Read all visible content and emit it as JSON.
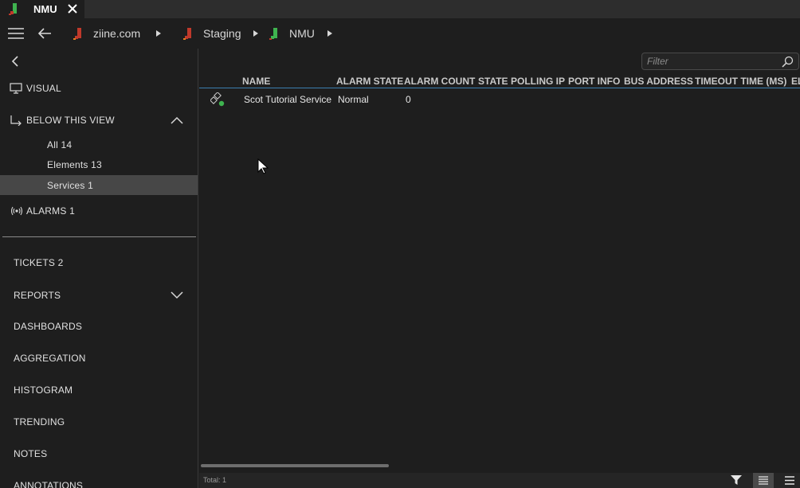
{
  "tab": {
    "label": "NMU",
    "icon": "element-icon"
  },
  "nav": {
    "breadcrumbs": [
      {
        "label": "ziine.com",
        "icon": "view-icon-red"
      },
      {
        "label": "Staging",
        "icon": "view-icon-red"
      },
      {
        "label": "NMU",
        "icon": "element-icon-green"
      }
    ]
  },
  "sidebar": {
    "visual_label": "VISUAL",
    "below_label": "BELOW THIS VIEW",
    "sub_items": [
      {
        "label": "All 14"
      },
      {
        "label": "Elements 13"
      },
      {
        "label": "Services 1",
        "selected": true
      }
    ],
    "alarms_label": "ALARMS 1",
    "items": [
      {
        "label": "TICKETS 2"
      },
      {
        "label": "REPORTS"
      },
      {
        "label": "DASHBOARDS"
      },
      {
        "label": "AGGREGATION"
      },
      {
        "label": "HISTOGRAM"
      },
      {
        "label": "TRENDING"
      },
      {
        "label": "NOTES"
      },
      {
        "label": "ANNOTATIONS"
      }
    ]
  },
  "filter": {
    "placeholder": "Filter"
  },
  "table": {
    "columns": [
      "NAME",
      "ALARM STATE",
      "ALARM COUNT",
      "STATE",
      "POLLING IP",
      "PORT INFO",
      "BUS ADDRESS",
      "TIMEOUT TIME (MS)",
      "EL"
    ],
    "rows": [
      {
        "name": "Scot Tutorial Service",
        "alarm_state": "Normal",
        "alarm_count": "0",
        "icon": "service-icon"
      }
    ]
  },
  "footer": {
    "total": "Total: 1"
  },
  "colors": {
    "background": "#1e1e1e",
    "tabstrip": "#2d2d2d",
    "selected_row": "#474747",
    "header_underline": "#3c7fb1",
    "status_green": "#3fb34f",
    "view_red": "#c0392b"
  }
}
